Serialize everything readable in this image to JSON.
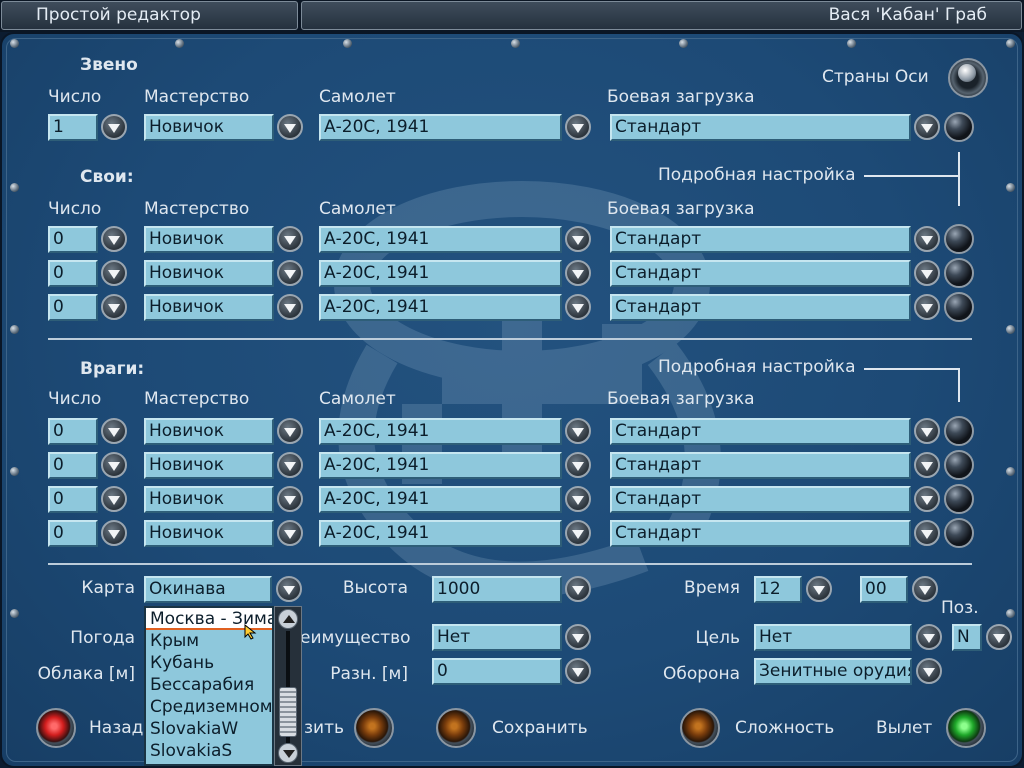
{
  "app": {
    "title": "Простой редактор",
    "user": "Вася 'Кабан' Граб"
  },
  "columns": {
    "count": "Число",
    "skill": "Мастерство",
    "plane": "Самолет",
    "loadout": "Боевая загрузка"
  },
  "flight": {
    "heading": "Звено",
    "axis_label": "Страны Оси",
    "row": {
      "count": "1",
      "skill": "Новичок",
      "plane": "А-20С, 1941",
      "loadout": "Стандарт"
    }
  },
  "friends": {
    "heading": "Свои:",
    "detail_label": "Подробная настройка",
    "rows": [
      {
        "count": "0",
        "skill": "Новичок",
        "plane": "А-20С, 1941",
        "loadout": "Стандарт"
      },
      {
        "count": "0",
        "skill": "Новичок",
        "plane": "А-20С, 1941",
        "loadout": "Стандарт"
      },
      {
        "count": "0",
        "skill": "Новичок",
        "plane": "А-20С, 1941",
        "loadout": "Стандарт"
      }
    ]
  },
  "enemies": {
    "heading": "Враги:",
    "detail_label": "Подробная настройка",
    "rows": [
      {
        "count": "0",
        "skill": "Новичок",
        "plane": "А-20С, 1941",
        "loadout": "Стандарт"
      },
      {
        "count": "0",
        "skill": "Новичок",
        "plane": "А-20С, 1941",
        "loadout": "Стандарт"
      },
      {
        "count": "0",
        "skill": "Новичок",
        "plane": "А-20С, 1941",
        "loadout": "Стандарт"
      },
      {
        "count": "0",
        "skill": "Новичок",
        "plane": "А-20С, 1941",
        "loadout": "Стандарт"
      }
    ]
  },
  "settings": {
    "map_label": "Карта",
    "map_value": "Окинава",
    "weather_label": "Погода",
    "clouds_label": "Облака [м]",
    "altitude_label": "Высота",
    "altitude_value": "1000",
    "advantage_label": "еимущество",
    "advantage_value": "Нет",
    "diff_label": "Разн. [м]",
    "diff_value": "0",
    "time_label": "Время",
    "time_hours": "12",
    "time_minutes": "00",
    "pos_label": "Поз.",
    "pos_value": "N",
    "target_label": "Цель",
    "target_value": "Нет",
    "defense_label": "Оборона",
    "defense_value": "Зенитные орудия"
  },
  "map_dropdown": {
    "items": [
      "Москва - Зима",
      "Крым",
      "Кубань",
      "Бессарабия",
      "Средиземном",
      "SlovakiaW",
      "SlovakiaS"
    ],
    "selected_index": 0
  },
  "buttons": {
    "back": "Назад",
    "load_partial": "зить",
    "save": "Сохранить",
    "difficulty": "Сложность",
    "fly": "Вылет"
  },
  "colors": {
    "panel": "#1d4a76",
    "field": "#8ec8dc",
    "text": "#dfe7ef"
  }
}
